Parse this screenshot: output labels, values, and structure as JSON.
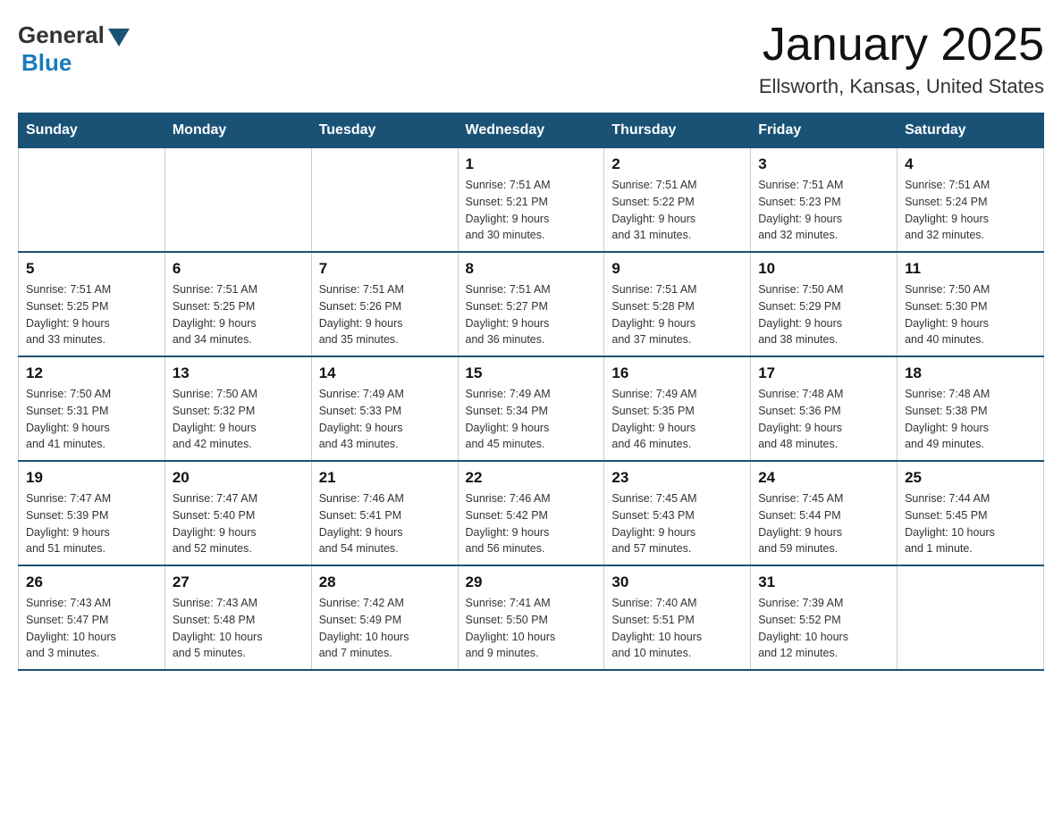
{
  "logo": {
    "general": "General",
    "blue": "Blue"
  },
  "title": "January 2025",
  "subtitle": "Ellsworth, Kansas, United States",
  "days_header": [
    "Sunday",
    "Monday",
    "Tuesday",
    "Wednesday",
    "Thursday",
    "Friday",
    "Saturday"
  ],
  "weeks": [
    [
      {
        "day": "",
        "info": ""
      },
      {
        "day": "",
        "info": ""
      },
      {
        "day": "",
        "info": ""
      },
      {
        "day": "1",
        "info": "Sunrise: 7:51 AM\nSunset: 5:21 PM\nDaylight: 9 hours\nand 30 minutes."
      },
      {
        "day": "2",
        "info": "Sunrise: 7:51 AM\nSunset: 5:22 PM\nDaylight: 9 hours\nand 31 minutes."
      },
      {
        "day": "3",
        "info": "Sunrise: 7:51 AM\nSunset: 5:23 PM\nDaylight: 9 hours\nand 32 minutes."
      },
      {
        "day": "4",
        "info": "Sunrise: 7:51 AM\nSunset: 5:24 PM\nDaylight: 9 hours\nand 32 minutes."
      }
    ],
    [
      {
        "day": "5",
        "info": "Sunrise: 7:51 AM\nSunset: 5:25 PM\nDaylight: 9 hours\nand 33 minutes."
      },
      {
        "day": "6",
        "info": "Sunrise: 7:51 AM\nSunset: 5:25 PM\nDaylight: 9 hours\nand 34 minutes."
      },
      {
        "day": "7",
        "info": "Sunrise: 7:51 AM\nSunset: 5:26 PM\nDaylight: 9 hours\nand 35 minutes."
      },
      {
        "day": "8",
        "info": "Sunrise: 7:51 AM\nSunset: 5:27 PM\nDaylight: 9 hours\nand 36 minutes."
      },
      {
        "day": "9",
        "info": "Sunrise: 7:51 AM\nSunset: 5:28 PM\nDaylight: 9 hours\nand 37 minutes."
      },
      {
        "day": "10",
        "info": "Sunrise: 7:50 AM\nSunset: 5:29 PM\nDaylight: 9 hours\nand 38 minutes."
      },
      {
        "day": "11",
        "info": "Sunrise: 7:50 AM\nSunset: 5:30 PM\nDaylight: 9 hours\nand 40 minutes."
      }
    ],
    [
      {
        "day": "12",
        "info": "Sunrise: 7:50 AM\nSunset: 5:31 PM\nDaylight: 9 hours\nand 41 minutes."
      },
      {
        "day": "13",
        "info": "Sunrise: 7:50 AM\nSunset: 5:32 PM\nDaylight: 9 hours\nand 42 minutes."
      },
      {
        "day": "14",
        "info": "Sunrise: 7:49 AM\nSunset: 5:33 PM\nDaylight: 9 hours\nand 43 minutes."
      },
      {
        "day": "15",
        "info": "Sunrise: 7:49 AM\nSunset: 5:34 PM\nDaylight: 9 hours\nand 45 minutes."
      },
      {
        "day": "16",
        "info": "Sunrise: 7:49 AM\nSunset: 5:35 PM\nDaylight: 9 hours\nand 46 minutes."
      },
      {
        "day": "17",
        "info": "Sunrise: 7:48 AM\nSunset: 5:36 PM\nDaylight: 9 hours\nand 48 minutes."
      },
      {
        "day": "18",
        "info": "Sunrise: 7:48 AM\nSunset: 5:38 PM\nDaylight: 9 hours\nand 49 minutes."
      }
    ],
    [
      {
        "day": "19",
        "info": "Sunrise: 7:47 AM\nSunset: 5:39 PM\nDaylight: 9 hours\nand 51 minutes."
      },
      {
        "day": "20",
        "info": "Sunrise: 7:47 AM\nSunset: 5:40 PM\nDaylight: 9 hours\nand 52 minutes."
      },
      {
        "day": "21",
        "info": "Sunrise: 7:46 AM\nSunset: 5:41 PM\nDaylight: 9 hours\nand 54 minutes."
      },
      {
        "day": "22",
        "info": "Sunrise: 7:46 AM\nSunset: 5:42 PM\nDaylight: 9 hours\nand 56 minutes."
      },
      {
        "day": "23",
        "info": "Sunrise: 7:45 AM\nSunset: 5:43 PM\nDaylight: 9 hours\nand 57 minutes."
      },
      {
        "day": "24",
        "info": "Sunrise: 7:45 AM\nSunset: 5:44 PM\nDaylight: 9 hours\nand 59 minutes."
      },
      {
        "day": "25",
        "info": "Sunrise: 7:44 AM\nSunset: 5:45 PM\nDaylight: 10 hours\nand 1 minute."
      }
    ],
    [
      {
        "day": "26",
        "info": "Sunrise: 7:43 AM\nSunset: 5:47 PM\nDaylight: 10 hours\nand 3 minutes."
      },
      {
        "day": "27",
        "info": "Sunrise: 7:43 AM\nSunset: 5:48 PM\nDaylight: 10 hours\nand 5 minutes."
      },
      {
        "day": "28",
        "info": "Sunrise: 7:42 AM\nSunset: 5:49 PM\nDaylight: 10 hours\nand 7 minutes."
      },
      {
        "day": "29",
        "info": "Sunrise: 7:41 AM\nSunset: 5:50 PM\nDaylight: 10 hours\nand 9 minutes."
      },
      {
        "day": "30",
        "info": "Sunrise: 7:40 AM\nSunset: 5:51 PM\nDaylight: 10 hours\nand 10 minutes."
      },
      {
        "day": "31",
        "info": "Sunrise: 7:39 AM\nSunset: 5:52 PM\nDaylight: 10 hours\nand 12 minutes."
      },
      {
        "day": "",
        "info": ""
      }
    ]
  ]
}
